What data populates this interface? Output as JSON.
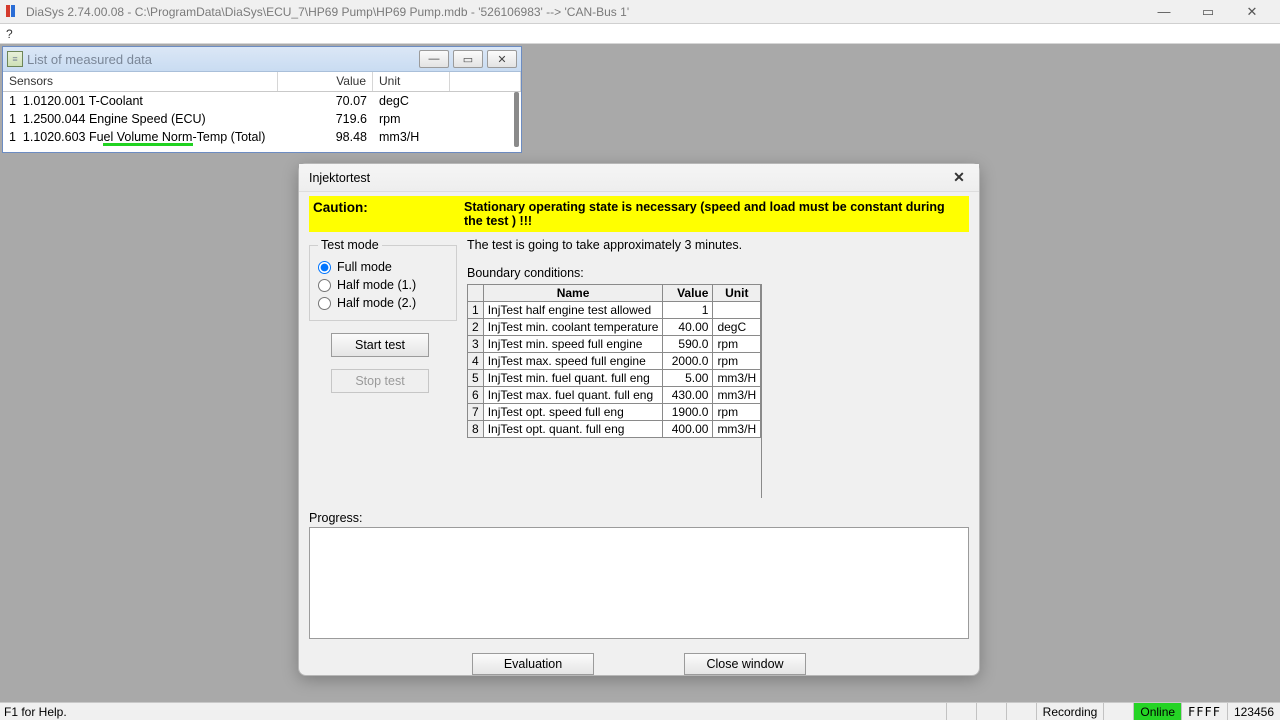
{
  "app": {
    "title": "DiaSys 2.74.00.08 - C:\\ProgramData\\DiaSys\\ECU_7\\HP69 Pump\\HP69 Pump.mdb - '526106983' --> 'CAN-Bus 1'",
    "help_menu": "?"
  },
  "measured": {
    "title": "List of measured data",
    "headers": {
      "sensors": "Sensors",
      "value": "Value",
      "unit": "Unit"
    },
    "rows": [
      {
        "idx": "1",
        "name": "1.0120.001 T-Coolant",
        "value": "70.07",
        "unit": "degC"
      },
      {
        "idx": "1",
        "name": "1.2500.044 Engine Speed (ECU)",
        "value": "719.6",
        "unit": "rpm"
      },
      {
        "idx": "1",
        "name": "1.1020.603 Fuel Volume Norm-Temp (Total)",
        "value": "98.48",
        "unit": "mm3/H"
      }
    ]
  },
  "dialog": {
    "title": "Injektortest",
    "caution_label": "Caution:",
    "caution_text": "Stationary operating state is necessary (speed and load must be constant during the test ) !!!",
    "test_mode_legend": "Test mode",
    "modes": {
      "full": "Full mode",
      "half1": "Half mode (1.)",
      "half2": "Half mode (2.)"
    },
    "start": "Start test",
    "stop": "Stop test",
    "info": "The test is going to take approximately 3 minutes.",
    "bc_label": "Boundary conditions:",
    "bc_headers": {
      "name": "Name",
      "value": "Value",
      "unit": "Unit"
    },
    "bc_rows": [
      {
        "i": "1",
        "name": "InjTest half engine test allowed",
        "value": "1",
        "unit": ""
      },
      {
        "i": "2",
        "name": "InjTest min. coolant temperature",
        "value": "40.00",
        "unit": "degC"
      },
      {
        "i": "3",
        "name": "InjTest min. speed full engine",
        "value": "590.0",
        "unit": "rpm"
      },
      {
        "i": "4",
        "name": "InjTest max. speed full engine",
        "value": "2000.0",
        "unit": "rpm"
      },
      {
        "i": "5",
        "name": "InjTest min. fuel quant. full eng",
        "value": "5.00",
        "unit": "mm3/H"
      },
      {
        "i": "6",
        "name": "InjTest max. fuel quant. full eng",
        "value": "430.00",
        "unit": "mm3/H"
      },
      {
        "i": "7",
        "name": "InjTest opt. speed full eng",
        "value": "1900.0",
        "unit": "rpm"
      },
      {
        "i": "8",
        "name": "InjTest opt. quant. full eng",
        "value": "400.00",
        "unit": "mm3/H"
      }
    ],
    "progress_label": "Progress:",
    "evaluation": "Evaluation",
    "close": "Close window"
  },
  "status": {
    "left": "F1 for Help.",
    "recording": "Recording",
    "online": "Online",
    "seg": "FFFF",
    "num": "123456"
  }
}
